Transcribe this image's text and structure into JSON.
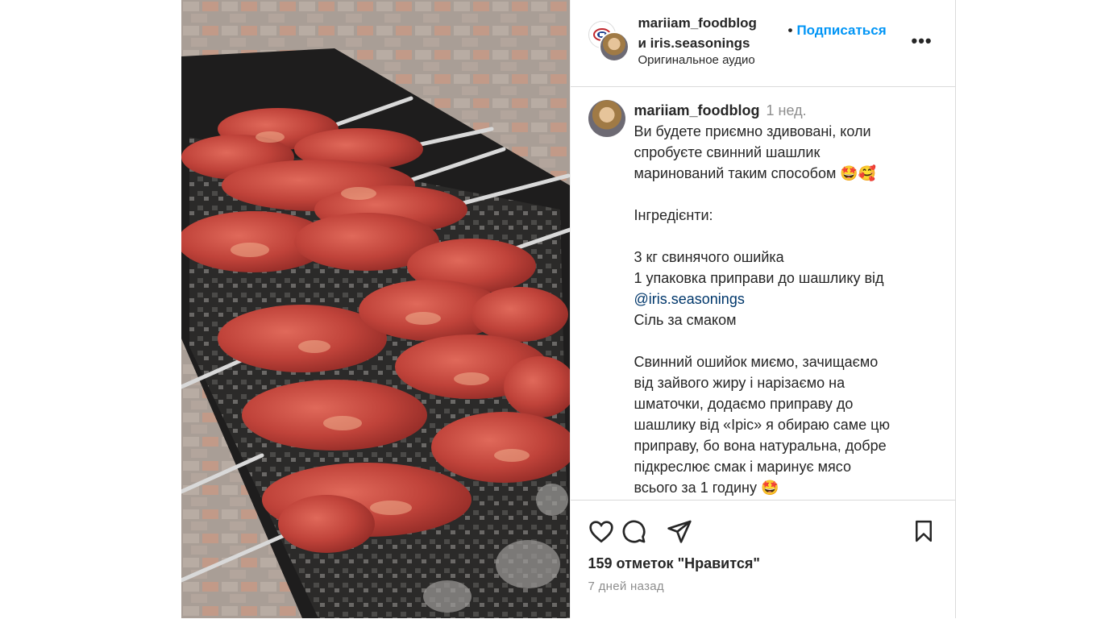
{
  "post": {
    "header": {
      "user1": "mariiam_foodblog",
      "and_user2": "и iris.seasonings",
      "follow_label": "Подписаться",
      "audio": "Оригинальное аудио"
    },
    "caption": {
      "username": "mariiam_foodblog",
      "time": "1 нед.",
      "lines": [
        "Ви будете приємно здивовані, коли",
        "спробуєте свинний шашлик",
        "маринований таким способом 🤩🥰",
        "",
        "Інгредієнти:",
        "",
        "3 кг свинячого ошийка",
        "1 упаковка приправи до шашлику від",
        "",
        "Сіль за смаком",
        "",
        "Свинний ошийок миємо, зачищаємо",
        "від зайвого жиру і нарізаємо на",
        "шматочки, додаємо приправу до",
        "шашлику від «Ірiс» я обираю саме цю",
        "приправу, бо вона натуральна, добре",
        "підкреслює смак і маринує мясо",
        "всього за 1 годину 🤩"
      ],
      "mention": "@iris.seasonings"
    },
    "likes": "159 отметок \"Нравится\"",
    "date": "7 дней назад"
  },
  "icons": {
    "like": "heart-icon",
    "comment": "comment-icon",
    "share": "send-icon",
    "save": "bookmark-icon",
    "more": "more-options-icon"
  },
  "colors": {
    "follow": "#0095f6",
    "mention": "#00376b",
    "muted": "#8e8e8e",
    "border": "#dbdbdb"
  }
}
